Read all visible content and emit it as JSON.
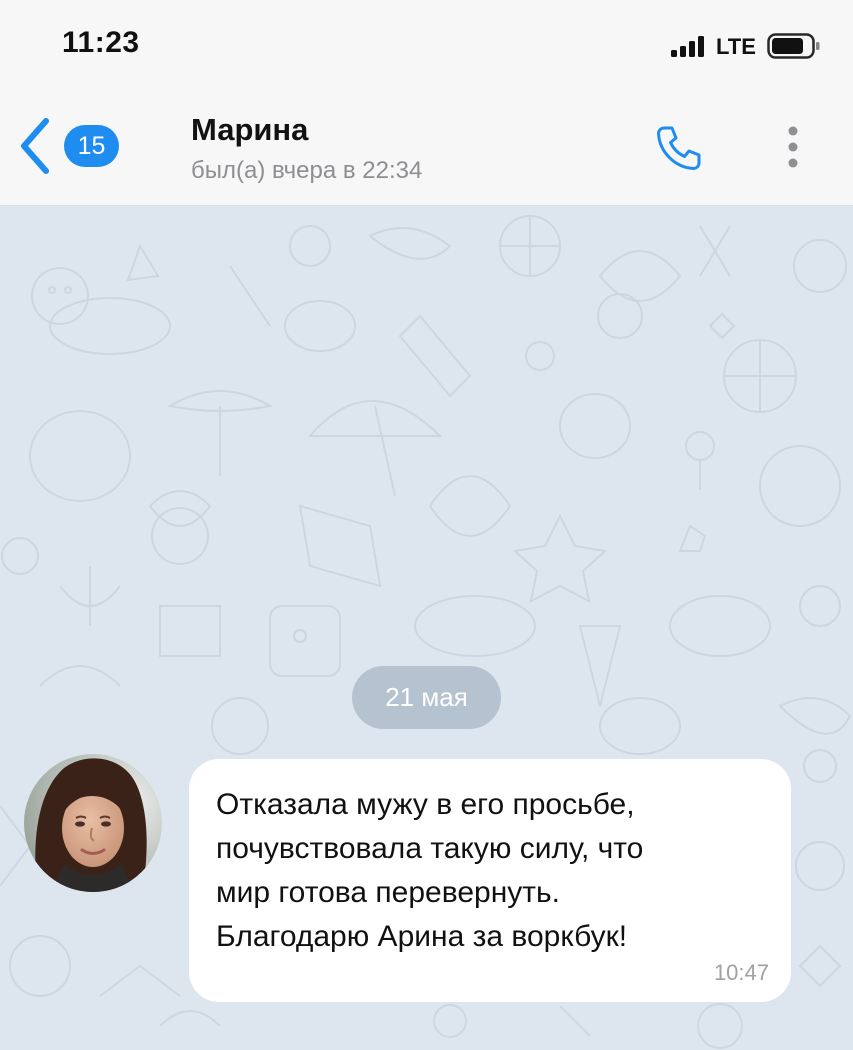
{
  "status_bar": {
    "time": "11:23",
    "network": "LTE",
    "signal_icon": "signal-bars-icon",
    "battery_icon": "battery-icon"
  },
  "header": {
    "back_icon": "chevron-left-icon",
    "unread_count": "15",
    "contact_name": "Марина",
    "contact_status": "был(а) вчера в 22:34",
    "call_icon": "phone-icon",
    "menu_icon": "more-vertical-icon"
  },
  "chat": {
    "date_separator": "21 мая",
    "message": {
      "text": "Отказала мужу в его просьбе,\nпочувствовала такую силу, что\nмир готова перевернуть.\nБлагодарю Арина за воркбук!",
      "time": "10:47"
    }
  },
  "colors": {
    "accent": "#1f8df0",
    "header_bg": "#f7f7f7",
    "chat_bg": "#dde6ef",
    "bubble_bg": "#ffffff",
    "muted_text": "#8e8e93"
  }
}
